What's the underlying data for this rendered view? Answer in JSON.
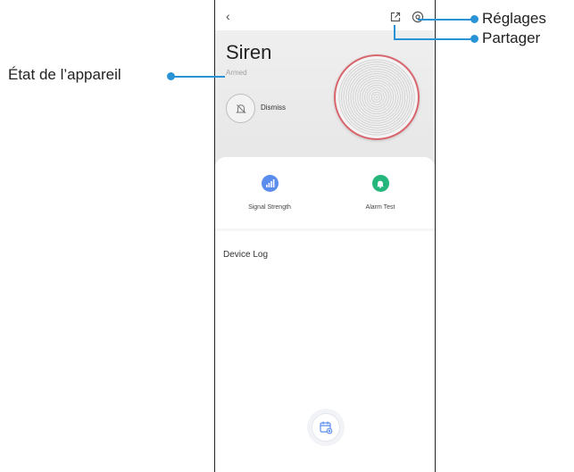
{
  "app": {
    "device_name": "Siren",
    "device_status": "Armed",
    "dismiss_label": "Dismiss"
  },
  "actions": [
    {
      "label": "Signal Strength",
      "icon": "signal-icon",
      "color": "#5b8def"
    },
    {
      "label": "Alarm Test",
      "icon": "bell-icon",
      "color": "#24b67a"
    }
  ],
  "log": {
    "title": "Device Log"
  },
  "callouts": {
    "settings": "Réglages",
    "share": "Partager",
    "device_state": "État de l’appareil"
  },
  "colors": {
    "accent": "#2a93d6",
    "device_ring": "#d9666e"
  }
}
